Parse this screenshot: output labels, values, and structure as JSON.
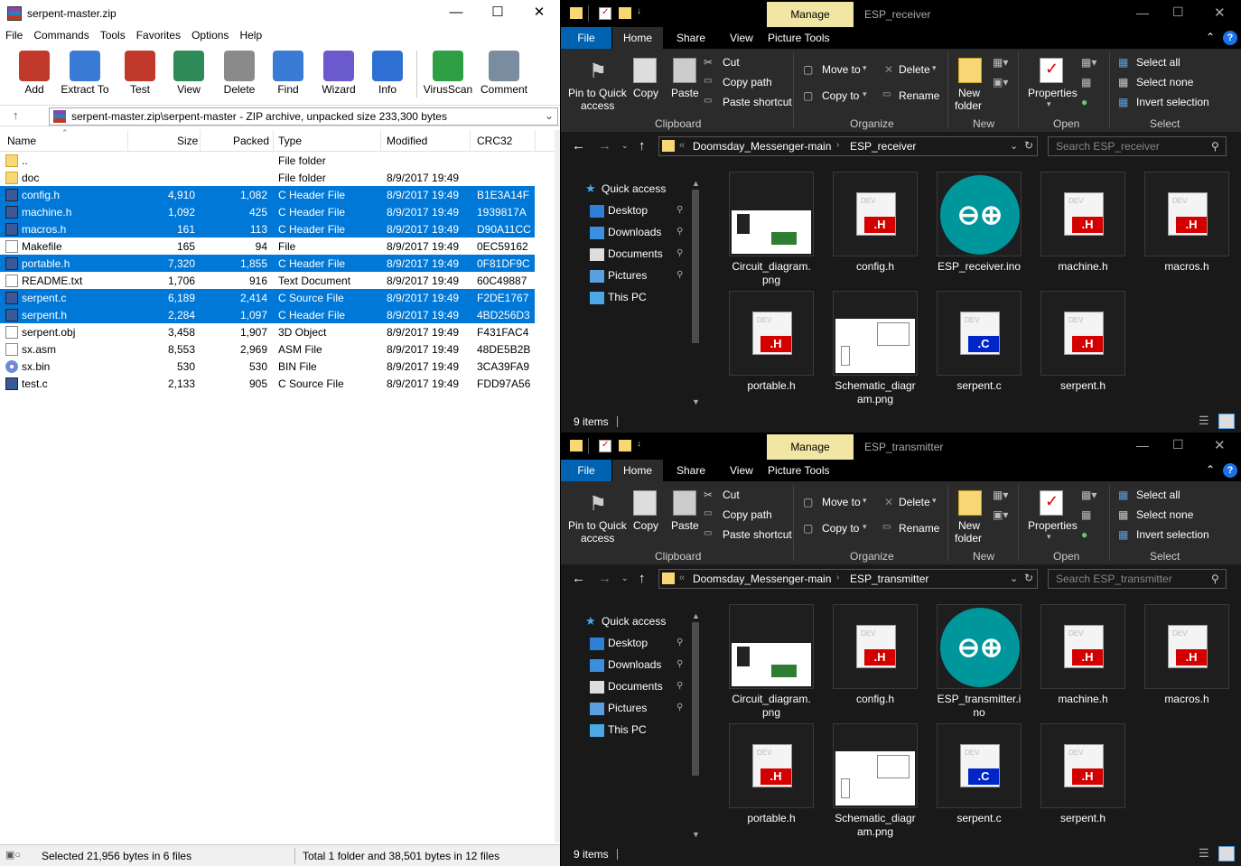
{
  "winrar": {
    "title": "serpent-master.zip",
    "menus": [
      "File",
      "Commands",
      "Tools",
      "Favorites",
      "Options",
      "Help"
    ],
    "toolbar": [
      {
        "label": "Add",
        "icon": "add-archive-icon",
        "color": "#c0392b"
      },
      {
        "label": "Extract To",
        "icon": "extract-folder-icon",
        "color": "#3a7bd5"
      },
      {
        "label": "Test",
        "icon": "test-checklist-icon",
        "color": "#c0392b"
      },
      {
        "label": "View",
        "icon": "view-book-icon",
        "color": "#2e8b57"
      },
      {
        "label": "Delete",
        "icon": "trash-icon",
        "color": "#8a8a8a"
      },
      {
        "label": "Find",
        "icon": "magnifier-icon",
        "color": "#3a7bd5"
      },
      {
        "label": "Wizard",
        "icon": "magic-wand-icon",
        "color": "#6a5acd"
      },
      {
        "label": "Info",
        "icon": "info-icon",
        "color": "#2d6fd2"
      },
      {
        "label": "VirusScan",
        "icon": "virus-scan-icon",
        "color": "#2ea043"
      },
      {
        "label": "Comment",
        "icon": "comment-icon",
        "color": "#7a8ca0"
      }
    ],
    "address": "serpent-master.zip\\serpent-master - ZIP archive, unpacked size 233,300 bytes",
    "columns": {
      "name": "Name",
      "size": "Size",
      "packed": "Packed",
      "type": "Type",
      "modified": "Modified",
      "crc": "CRC32"
    },
    "files": [
      {
        "name": "..",
        "size": "",
        "packed": "",
        "type": "File folder",
        "modified": "",
        "crc": "",
        "selected": false,
        "icon": "folder-icon"
      },
      {
        "name": "doc",
        "size": "",
        "packed": "",
        "type": "File folder",
        "modified": "8/9/2017 19:49",
        "crc": "",
        "selected": false,
        "icon": "folder-icon"
      },
      {
        "name": "config.h",
        "size": "4,910",
        "packed": "1,082",
        "type": "C Header File",
        "modified": "8/9/2017 19:49",
        "crc": "B1E3A14F",
        "selected": true,
        "icon": "header-file-icon"
      },
      {
        "name": "machine.h",
        "size": "1,092",
        "packed": "425",
        "type": "C Header File",
        "modified": "8/9/2017 19:49",
        "crc": "1939817A",
        "selected": true,
        "icon": "header-file-icon"
      },
      {
        "name": "macros.h",
        "size": "161",
        "packed": "113",
        "type": "C Header File",
        "modified": "8/9/2017 19:49",
        "crc": "D90A11CC",
        "selected": true,
        "icon": "header-file-icon"
      },
      {
        "name": "Makefile",
        "size": "165",
        "packed": "94",
        "type": "File",
        "modified": "8/9/2017 19:49",
        "crc": "0EC59162",
        "selected": false,
        "icon": "blank-file-icon"
      },
      {
        "name": "portable.h",
        "size": "7,320",
        "packed": "1,855",
        "type": "C Header File",
        "modified": "8/9/2017 19:49",
        "crc": "0F81DF9C",
        "selected": true,
        "icon": "header-file-icon"
      },
      {
        "name": "README.txt",
        "size": "1,706",
        "packed": "916",
        "type": "Text Document",
        "modified": "8/9/2017 19:49",
        "crc": "60C49887",
        "selected": false,
        "icon": "text-file-icon"
      },
      {
        "name": "serpent.c",
        "size": "6,189",
        "packed": "2,414",
        "type": "C Source File",
        "modified": "8/9/2017 19:49",
        "crc": "F2DE1767",
        "selected": true,
        "icon": "source-file-icon"
      },
      {
        "name": "serpent.h",
        "size": "2,284",
        "packed": "1,097",
        "type": "C Header File",
        "modified": "8/9/2017 19:49",
        "crc": "4BD256D3",
        "selected": true,
        "icon": "header-file-icon"
      },
      {
        "name": "serpent.obj",
        "size": "3,458",
        "packed": "1,907",
        "type": "3D Object",
        "modified": "8/9/2017 19:49",
        "crc": "F431FAC4",
        "selected": false,
        "icon": "object-file-icon"
      },
      {
        "name": "sx.asm",
        "size": "8,553",
        "packed": "2,969",
        "type": "ASM File",
        "modified": "8/9/2017 19:49",
        "crc": "48DE5B2B",
        "selected": false,
        "icon": "blank-file-icon"
      },
      {
        "name": "sx.bin",
        "size": "530",
        "packed": "530",
        "type": "BIN File",
        "modified": "8/9/2017 19:49",
        "crc": "3CA39FA9",
        "selected": false,
        "icon": "disc-file-icon"
      },
      {
        "name": "test.c",
        "size": "2,133",
        "packed": "905",
        "type": "C Source File",
        "modified": "8/9/2017 19:49",
        "crc": "FDD97A56",
        "selected": false,
        "icon": "source-file-icon"
      }
    ],
    "status_left": "Selected 21,956 bytes in 6 files",
    "status_right": "Total 1 folder and 38,501 bytes in 12 files"
  },
  "ribbon_common": {
    "manage": "Manage",
    "tabs": [
      "File",
      "Home",
      "Share",
      "View",
      "Picture Tools"
    ],
    "pin": "Pin to Quick",
    "pin2": "access",
    "copy": "Copy",
    "paste": "Paste",
    "cut": "Cut",
    "copy_path": "Copy path",
    "paste_shortcut": "Paste shortcut",
    "move_to": "Move to",
    "copy_to": "Copy to",
    "delete": "Delete",
    "rename": "Rename",
    "new_folder": "New",
    "new_folder2": "folder",
    "properties": "Properties",
    "select_all": "Select all",
    "select_none": "Select none",
    "invert_selection": "Invert selection",
    "groups": [
      "Clipboard",
      "Organize",
      "New",
      "Open",
      "Select"
    ],
    "nav": [
      "Quick access",
      "Desktop",
      "Downloads",
      "Documents",
      "Pictures",
      "This PC"
    ],
    "crumb_root": "Doomsday_Messenger-main",
    "items": "9 items"
  },
  "explorer_receiver": {
    "title": "ESP_receiver",
    "folder": "ESP_receiver",
    "search": "Search ESP_receiver",
    "tiles": [
      {
        "name": "Circuit_diagram.",
        "name2": "png",
        "kind": "image"
      },
      {
        "name": "config.h",
        "name2": "",
        "kind": "header"
      },
      {
        "name": "ESP_receiver.ino",
        "name2": "",
        "kind": "arduino"
      },
      {
        "name": "machine.h",
        "name2": "",
        "kind": "header"
      },
      {
        "name": "macros.h",
        "name2": "",
        "kind": "header"
      },
      {
        "name": "portable.h",
        "name2": "",
        "kind": "header"
      },
      {
        "name": "Schematic_diagr",
        "name2": "am.png",
        "kind": "schematic"
      },
      {
        "name": "serpent.c",
        "name2": "",
        "kind": "source"
      },
      {
        "name": "serpent.h",
        "name2": "",
        "kind": "header"
      }
    ]
  },
  "explorer_transmitter": {
    "title": "ESP_transmitter",
    "folder": "ESP_transmitter",
    "search": "Search ESP_transmitter",
    "tiles": [
      {
        "name": "Circuit_diagram.",
        "name2": "png",
        "kind": "image"
      },
      {
        "name": "config.h",
        "name2": "",
        "kind": "header"
      },
      {
        "name": "ESP_transmitter.i",
        "name2": "no",
        "kind": "arduino"
      },
      {
        "name": "machine.h",
        "name2": "",
        "kind": "header"
      },
      {
        "name": "macros.h",
        "name2": "",
        "kind": "header"
      },
      {
        "name": "portable.h",
        "name2": "",
        "kind": "header"
      },
      {
        "name": "Schematic_diagr",
        "name2": "am.png",
        "kind": "schematic"
      },
      {
        "name": "serpent.c",
        "name2": "",
        "kind": "source"
      },
      {
        "name": "serpent.h",
        "name2": "",
        "kind": "header"
      }
    ]
  },
  "colors": {
    "selection": "#0078d7",
    "file_tab": "#0063b1",
    "manage_tab": "#f1e6a3",
    "arduino": "#00979c",
    "header_tag": "#d40000",
    "source_tag": "#0026c9"
  }
}
